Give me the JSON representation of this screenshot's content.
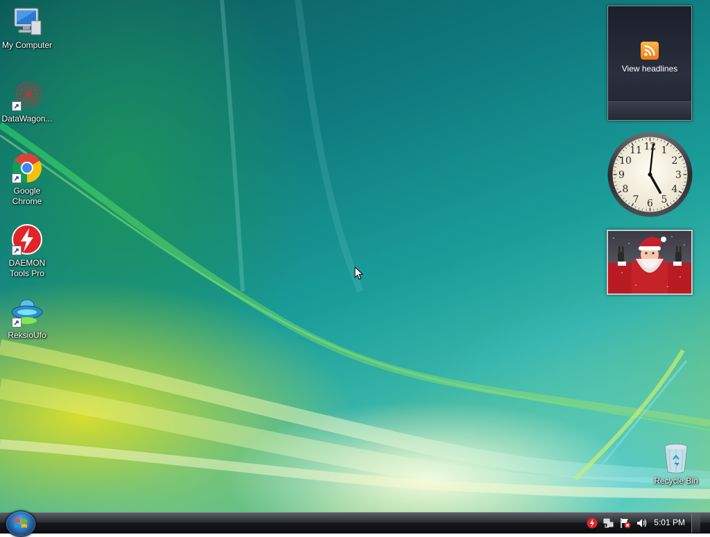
{
  "desktop": {
    "icons": [
      {
        "label": "My Computer",
        "icon": "computer-icon"
      },
      {
        "label": "DataWagon...",
        "icon": "datawagon-icon"
      },
      {
        "label": "Google Chrome",
        "icon": "chrome-icon"
      },
      {
        "label": "DAEMON Tools Pro",
        "icon": "daemon-tools-icon"
      },
      {
        "label": "ReksioUfo",
        "icon": "ufo-icon"
      }
    ],
    "recycle_bin": {
      "label": "Recycle Bin",
      "icon": "recycle-bin-icon"
    }
  },
  "gadgets": {
    "feed": {
      "label": "View headlines",
      "icon": "rss-icon",
      "color": "#f28c18"
    },
    "clock": {
      "hour": 5,
      "minute": 1,
      "numerals": [
        "12",
        "1",
        "2",
        "3",
        "4",
        "5",
        "6",
        "7",
        "8",
        "9",
        "10",
        "11"
      ]
    },
    "slideshow": {
      "subject": "santa-claus-photo"
    }
  },
  "taskbar": {
    "start_icon": "windows-logo-icon",
    "tray_icons": [
      "daemon-tray-icon",
      "network-icon",
      "action-center-flag-icon",
      "volume-icon"
    ],
    "time": "5:01 PM"
  }
}
